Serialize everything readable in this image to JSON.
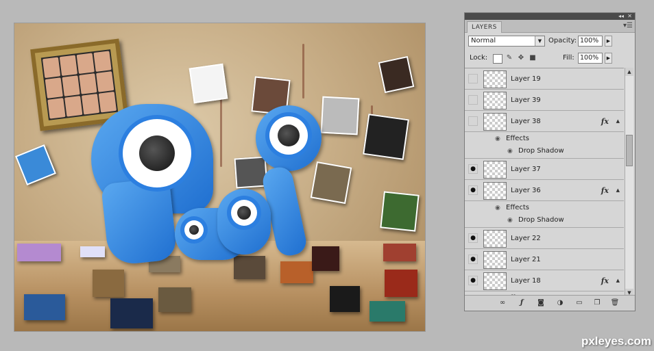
{
  "panel": {
    "tab_label": "LAYERS",
    "blend_mode": "Normal",
    "opacity_label": "Opacity:",
    "opacity_value": "100%",
    "lock_label": "Lock:",
    "fill_label": "Fill:",
    "fill_value": "100%",
    "layers": [
      {
        "name": "Layer 19",
        "visible": false,
        "fx": false
      },
      {
        "name": "Layer 39",
        "visible": false,
        "fx": false
      },
      {
        "name": "Layer 38",
        "visible": false,
        "fx": true,
        "effects_label": "Effects",
        "effect": "Drop Shadow"
      },
      {
        "name": "Layer 37",
        "visible": true,
        "fx": false
      },
      {
        "name": "Layer 36",
        "visible": true,
        "fx": true,
        "effects_label": "Effects",
        "effect": "Drop Shadow"
      },
      {
        "name": "Layer 22",
        "visible": true,
        "fx": false
      },
      {
        "name": "Layer 21",
        "visible": true,
        "fx": false
      },
      {
        "name": "Layer 18",
        "visible": true,
        "fx": true,
        "effects_label": "Effects"
      }
    ],
    "fx_label": "fx"
  },
  "watermark": "pxleyes.com"
}
